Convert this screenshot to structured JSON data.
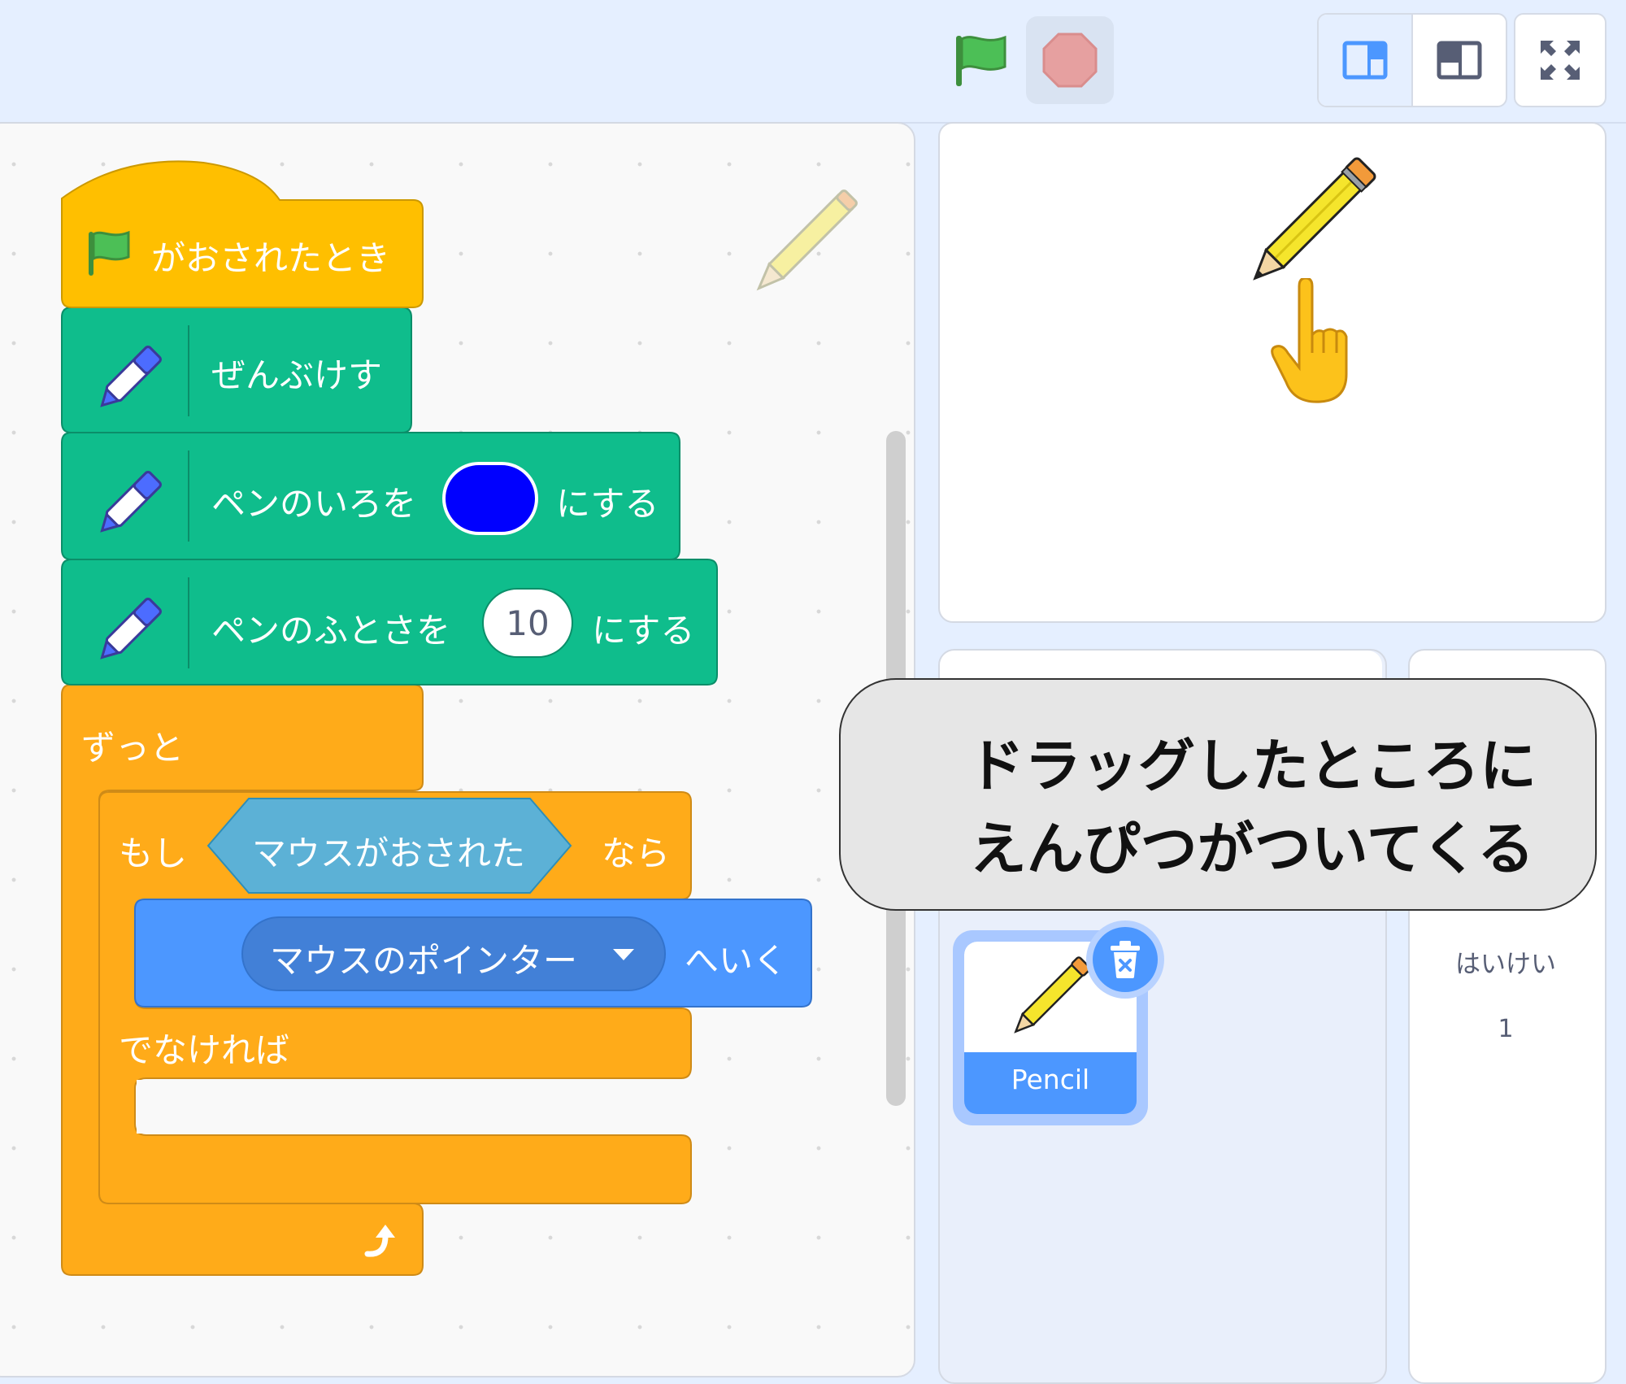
{
  "code": {
    "hat_label": "がおされたとき",
    "clear_label": "ぜんぶけす",
    "set_color": {
      "prefix": "ペンのいろを",
      "suffix": "にする",
      "color": "#0000ff"
    },
    "set_size": {
      "prefix": "ペンのふとさを",
      "value": "10",
      "suffix": "にする"
    },
    "forever_label": "ずっと",
    "if_block": {
      "if_label": "もし",
      "condition": "マウスがおされた",
      "then_label": "なら",
      "else_label": "でなければ"
    },
    "goto_block": {
      "target": "マウスのポインター",
      "suffix": "へいく"
    }
  },
  "sprites": [
    {
      "name": "Pencil",
      "selected": true
    }
  ],
  "backdrop": {
    "label": "はいけい",
    "count": "1"
  },
  "callout": {
    "line1": "ドラッグしたところに",
    "line2": "えんぴつがついてくる"
  },
  "colors": {
    "event": "#ffbf00",
    "pen": "#0fbd8c",
    "control": "#ffab19",
    "motion": "#4c97ff",
    "sensing": "#5cb1d6",
    "stage_bg": "#e5efff"
  },
  "icons": [
    "green-flag-icon",
    "stop-icon",
    "small-stage-icon",
    "large-stage-icon",
    "fullscreen-icon",
    "pen-extension-icon",
    "trash-icon",
    "loop-arrow-icon",
    "dropdown-arrow-icon",
    "pencil-sprite",
    "pointing-hand"
  ]
}
